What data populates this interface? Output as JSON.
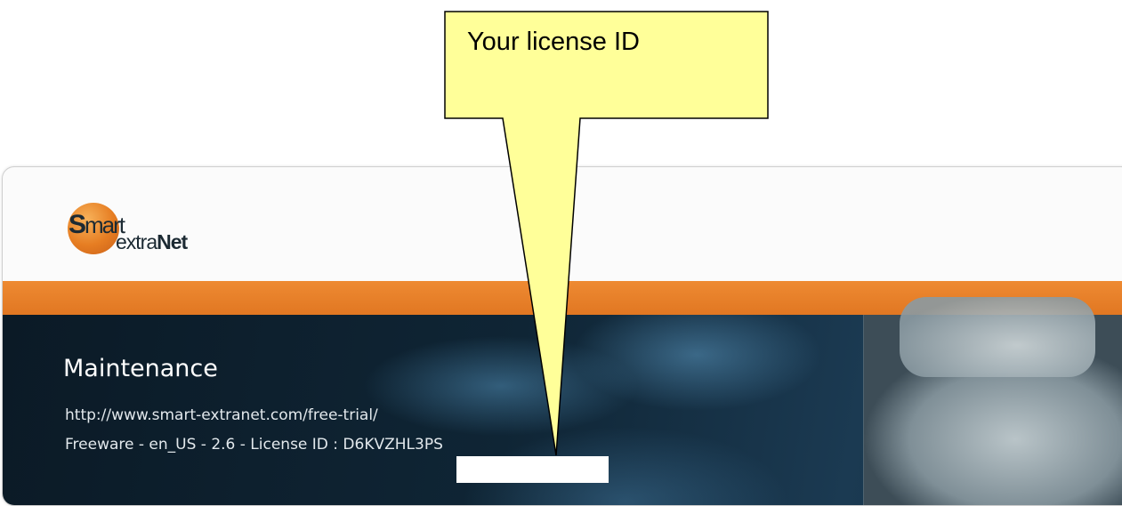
{
  "logo": {
    "smart_text": "Smart",
    "extranet_text": "extraNet"
  },
  "colors": {
    "accent_orange": "#e67d22",
    "callout_fill": "#ffff99"
  },
  "banner": {
    "title": "Maintenance",
    "url": "http://www.smart-extranet.com/free-trial/",
    "info": "Freeware - en_US - 2.6 - License ID : D6KVZHL3PS"
  },
  "callout": {
    "text": "Your license ID"
  }
}
